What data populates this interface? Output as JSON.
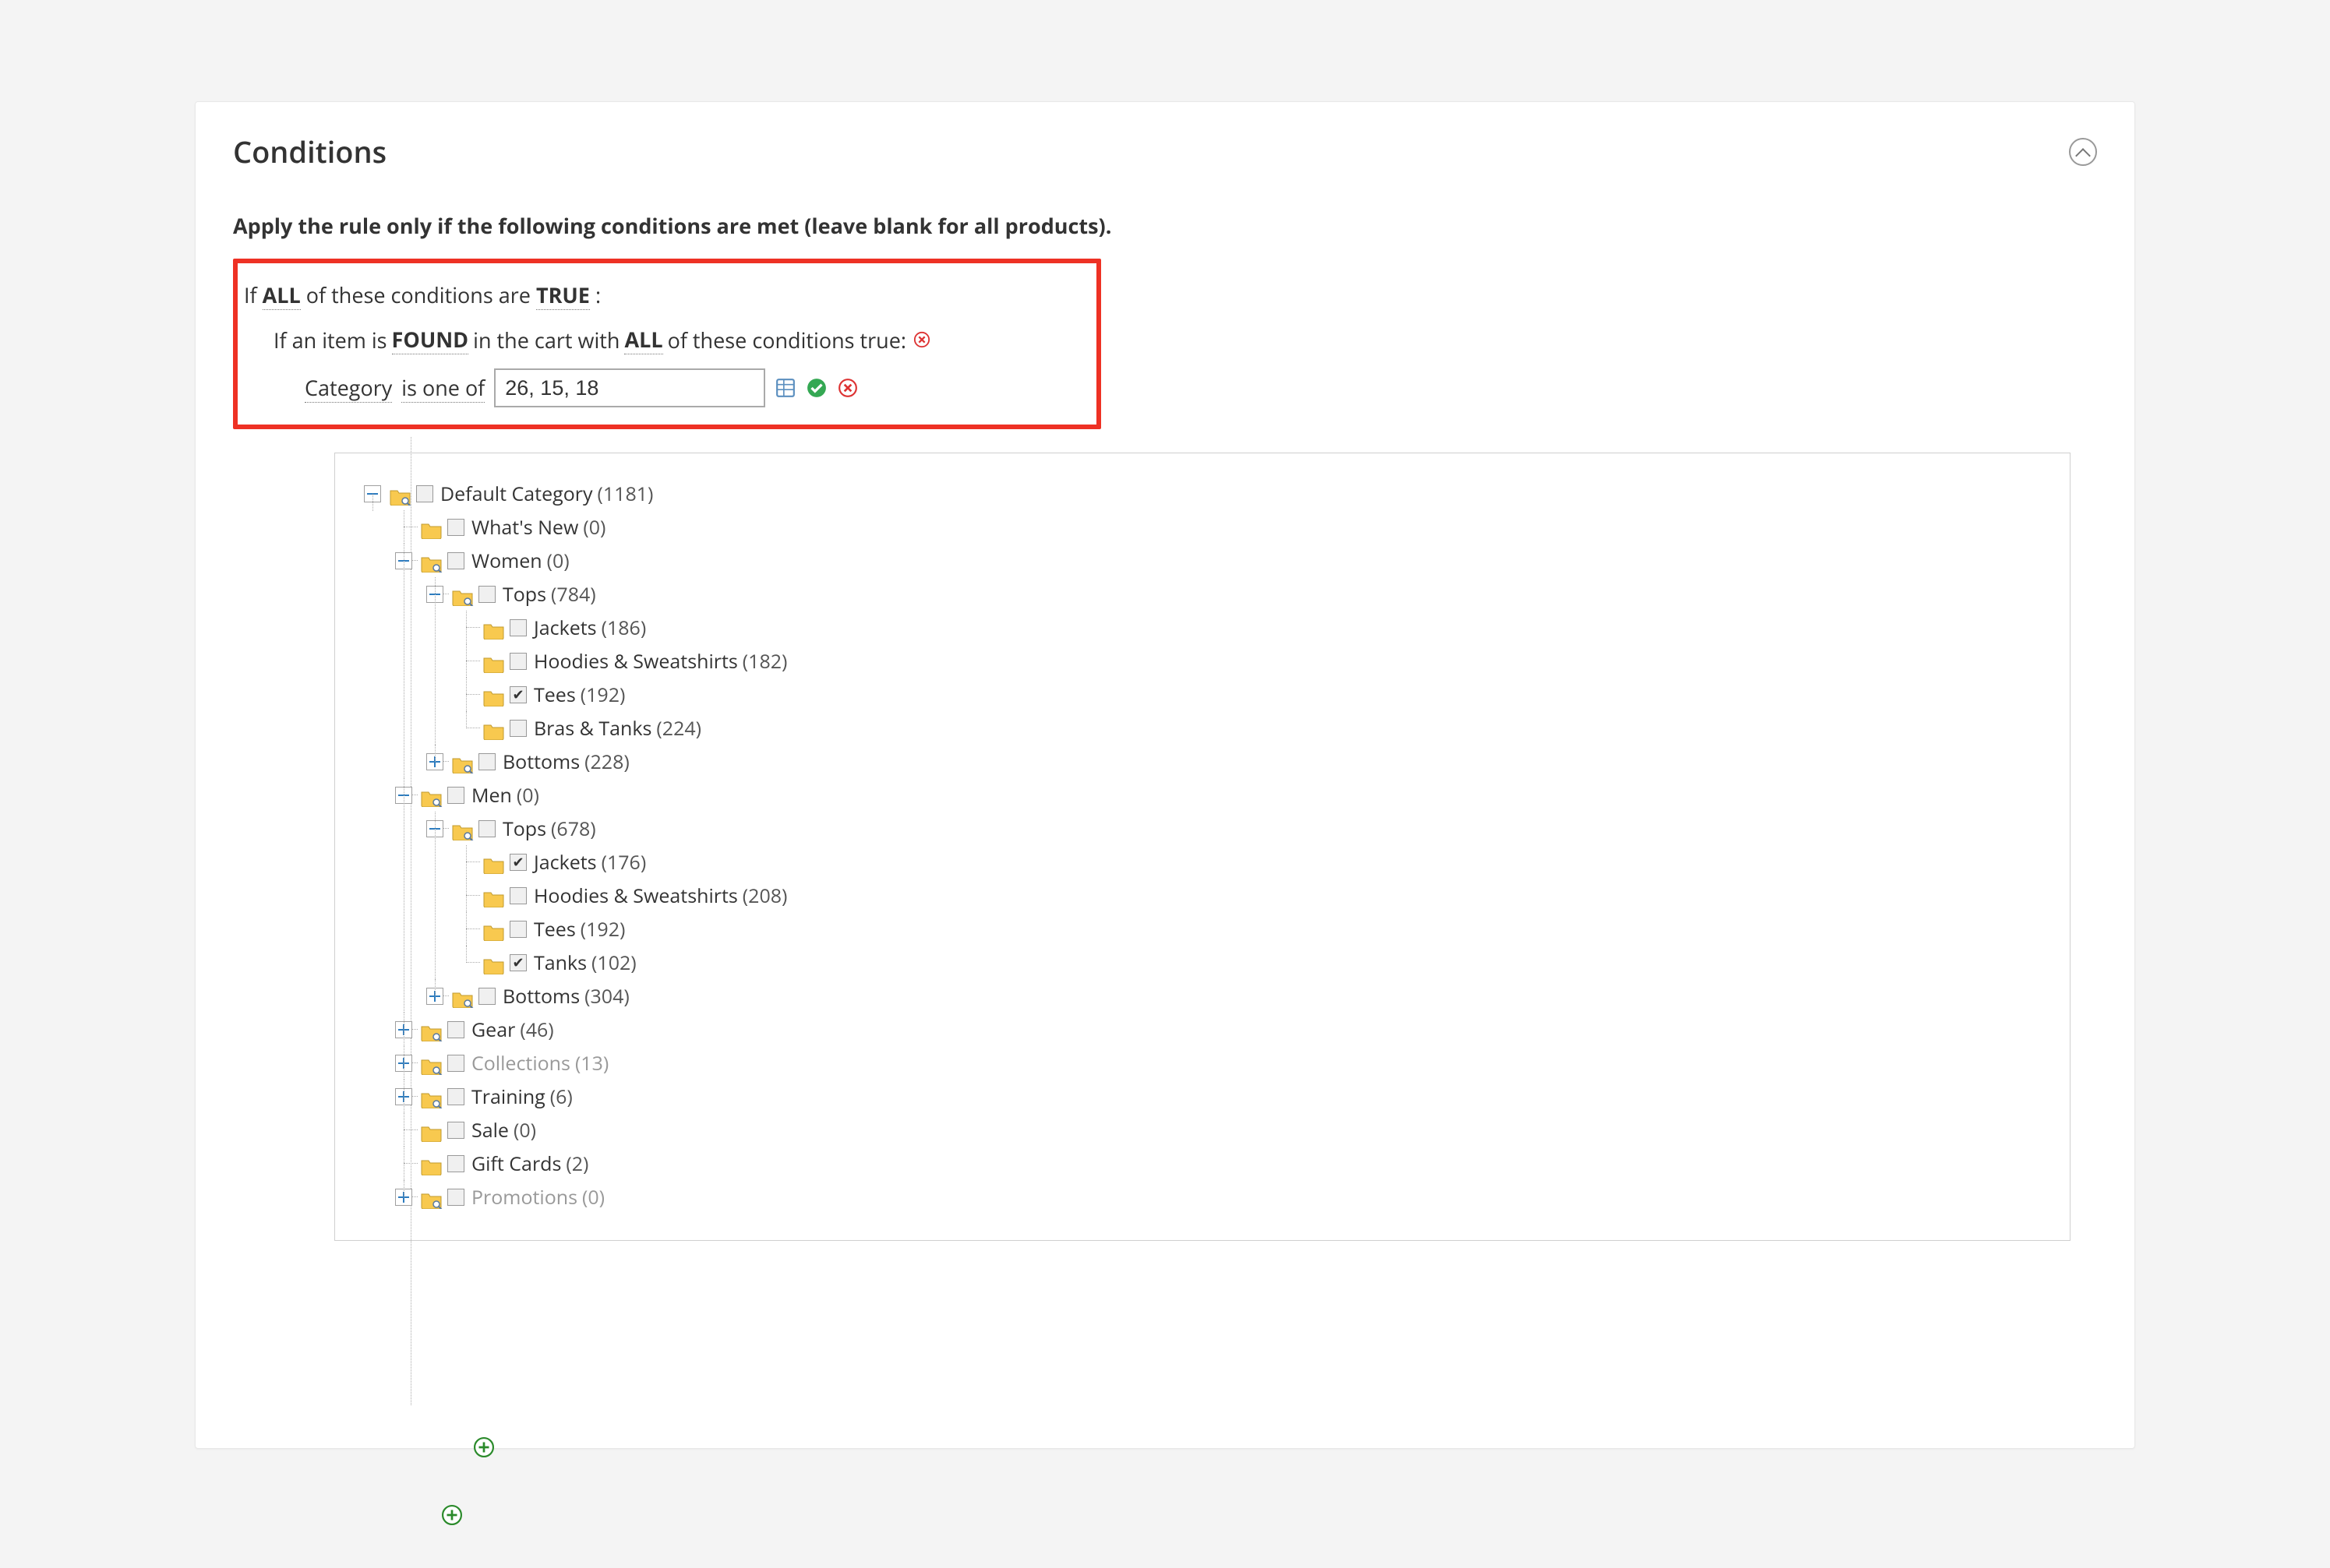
{
  "header": {
    "title": "Conditions"
  },
  "intro": {
    "prefix": "Apply the rule only if the following conditions are met (leave blank for ",
    "bold": "all",
    "suffix": " products)."
  },
  "ruleBox": {
    "line1_prefix": "If ",
    "line1_all": "ALL",
    "line1_mid": "  of these conditions are ",
    "line1_true": "TRUE",
    "line1_suffix": " :",
    "line2_prefix": "If an item is ",
    "line2_found": "FOUND",
    "line2_mid": "  in the cart with ",
    "line2_all": "ALL",
    "line2_suffix": "  of these conditions true: ",
    "line3_attr": "Category",
    "line3_op": " is one of ",
    "line3_value": "26, 15, 18"
  },
  "tree": [
    {
      "id": "root",
      "label": "Default Category",
      "count": 1181,
      "open": true,
      "exp": "minus",
      "checked": false,
      "children": [
        {
          "id": "whatsnew",
          "label": "What's New",
          "count": 0,
          "open": null,
          "exp": null,
          "checked": false
        },
        {
          "id": "women",
          "label": "Women",
          "count": 0,
          "open": true,
          "exp": "minus",
          "checked": false,
          "children": [
            {
              "id": "wtops",
              "label": "Tops",
              "count": 784,
              "open": true,
              "exp": "minus",
              "checked": false,
              "children": [
                {
                  "id": "wjackets",
                  "label": "Jackets",
                  "count": 186,
                  "exp": null,
                  "checked": false
                },
                {
                  "id": "whoodies",
                  "label": "Hoodies & Sweatshirts",
                  "count": 182,
                  "exp": null,
                  "checked": false
                },
                {
                  "id": "wtees",
                  "label": "Tees",
                  "count": 192,
                  "exp": null,
                  "checked": true
                },
                {
                  "id": "wbras",
                  "label": "Bras & Tanks",
                  "count": 224,
                  "exp": null,
                  "checked": false
                }
              ]
            },
            {
              "id": "wbottoms",
              "label": "Bottoms",
              "count": 228,
              "exp": "plus",
              "checked": false
            }
          ]
        },
        {
          "id": "men",
          "label": "Men",
          "count": 0,
          "open": true,
          "exp": "minus",
          "checked": false,
          "children": [
            {
              "id": "mtops",
              "label": "Tops",
              "count": 678,
              "open": true,
              "exp": "minus",
              "checked": false,
              "children": [
                {
                  "id": "mjackets",
                  "label": "Jackets",
                  "count": 176,
                  "exp": null,
                  "checked": true
                },
                {
                  "id": "mhoodies",
                  "label": "Hoodies & Sweatshirts",
                  "count": 208,
                  "exp": null,
                  "checked": false
                },
                {
                  "id": "mtees",
                  "label": "Tees",
                  "count": 192,
                  "exp": null,
                  "checked": false
                },
                {
                  "id": "mtanks",
                  "label": "Tanks",
                  "count": 102,
                  "exp": null,
                  "checked": true
                }
              ]
            },
            {
              "id": "mbottoms",
              "label": "Bottoms",
              "count": 304,
              "exp": "plus",
              "checked": false
            }
          ]
        },
        {
          "id": "gear",
          "label": "Gear",
          "count": 46,
          "exp": "plus",
          "checked": false
        },
        {
          "id": "coll",
          "label": "Collections",
          "count": 13,
          "exp": "plus",
          "checked": false,
          "muted": true
        },
        {
          "id": "train",
          "label": "Training",
          "count": 6,
          "exp": "plus",
          "checked": false
        },
        {
          "id": "sale",
          "label": "Sale",
          "count": 0,
          "exp": null,
          "checked": false
        },
        {
          "id": "giftcards",
          "label": "Gift Cards",
          "count": 2,
          "exp": null,
          "checked": false
        },
        {
          "id": "promo",
          "label": "Promotions",
          "count": 0,
          "exp": "plus",
          "checked": false,
          "muted": true
        }
      ]
    }
  ]
}
